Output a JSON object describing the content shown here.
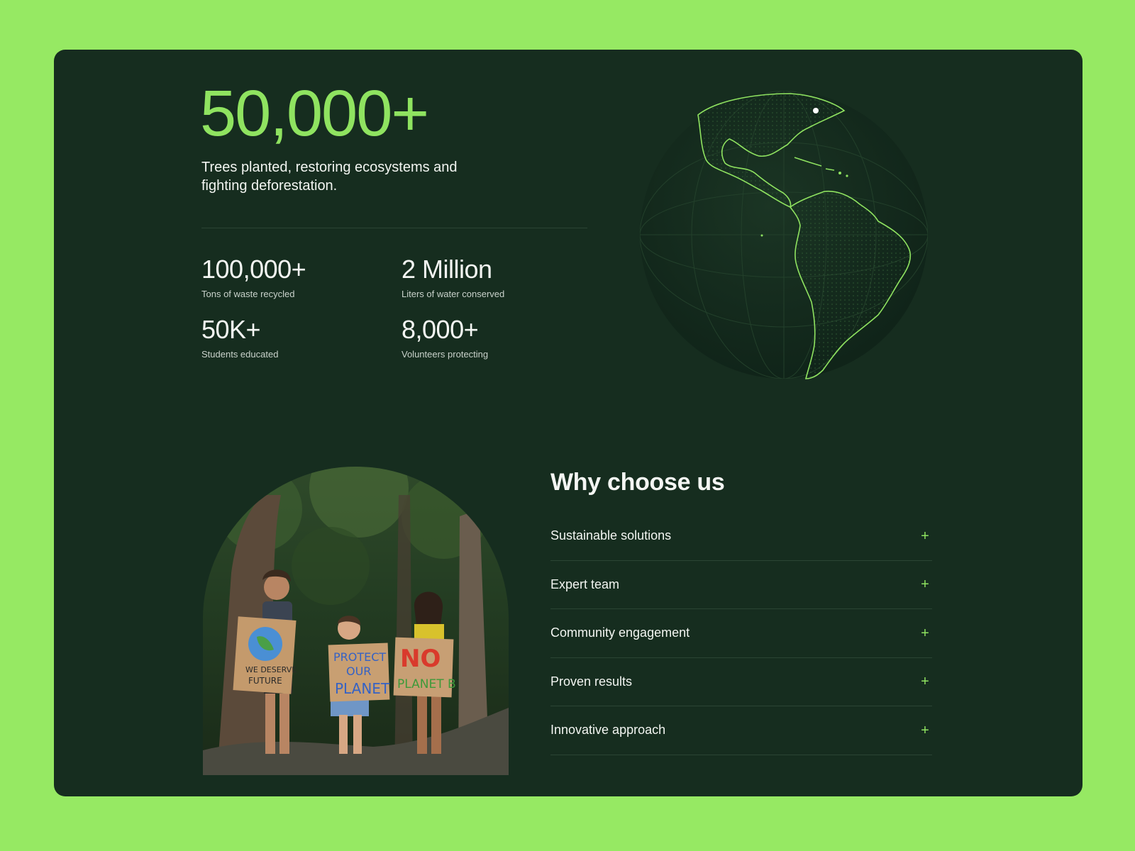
{
  "colors": {
    "page_bg": "#96e963",
    "card_bg": "#162d1f",
    "accent": "#8fe360",
    "text": "#f4f6f3"
  },
  "hero": {
    "number": "50,000+",
    "description": "Trees planted, restoring ecosystems and fighting deforestation."
  },
  "stats": [
    {
      "value": "100,000+",
      "label": "Tons of waste recycled"
    },
    {
      "value": "2 Million",
      "label": "Liters of water conserved"
    },
    {
      "value": "50K+",
      "label": "Students educated"
    },
    {
      "value": "8,000+",
      "label": "Volunteers protecting"
    }
  ],
  "globe": {
    "icon": "globe-americas-icon"
  },
  "photo": {
    "signs": [
      "WE DESERVE A FUTURE",
      "PROTECT OUR PLANET",
      "NO PLANET B"
    ]
  },
  "why": {
    "title": "Why choose us",
    "items": [
      {
        "label": "Sustainable solutions",
        "icon": "plus-icon"
      },
      {
        "label": "Expert team",
        "icon": "plus-icon"
      },
      {
        "label": "Community engagement",
        "icon": "plus-icon"
      },
      {
        "label": "Proven results",
        "icon": "plus-icon"
      },
      {
        "label": "Innovative approach",
        "icon": "plus-icon"
      }
    ]
  }
}
